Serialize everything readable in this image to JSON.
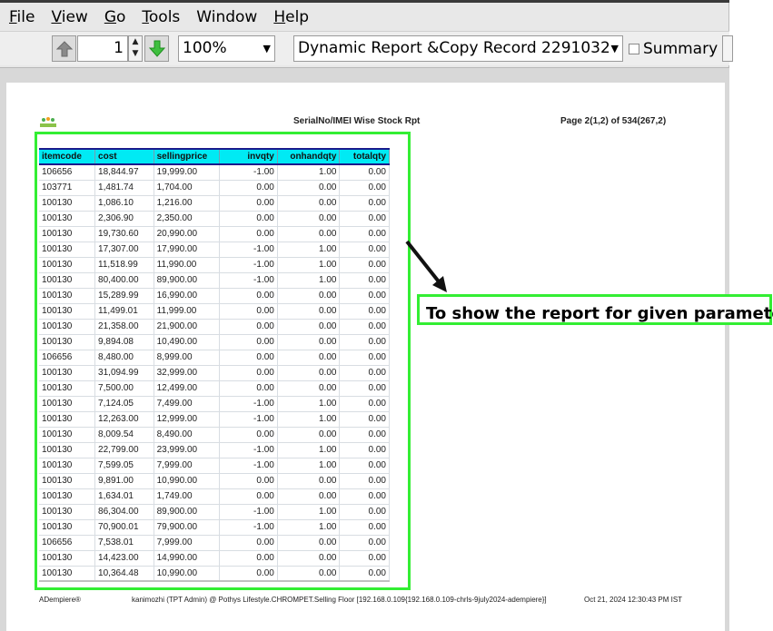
{
  "menu": [
    {
      "label": "File",
      "u": "F",
      "rest": "ile"
    },
    {
      "label": "View",
      "u": "V",
      "rest": "iew"
    },
    {
      "label": "Go",
      "u": "G",
      "rest": "o"
    },
    {
      "label": "Tools",
      "u": "T",
      "rest": "ools"
    },
    {
      "label": "Window",
      "u": "",
      "rest": "Window"
    },
    {
      "label": "Help",
      "u": "H",
      "rest": "elp"
    }
  ],
  "toolbar": {
    "page_value": "1",
    "zoom_value": "100%",
    "report_value": "Dynamic Report &Copy Record 2291032",
    "summary_label": "Summary",
    "summary_checked": false
  },
  "report": {
    "title": "SerialNo/IMEI Wise Stock Rpt",
    "page_info": "Page 2(1,2) of 534(267,2)",
    "columns": [
      "itemcode",
      "cost",
      "sellingprice",
      "invqty",
      "onhandqty",
      "totalqty"
    ],
    "rows": [
      [
        "106656",
        "18,844.97",
        "19,999.00",
        "-1.00",
        "1.00",
        "0.00"
      ],
      [
        "103771",
        "1,481.74",
        "1,704.00",
        "0.00",
        "0.00",
        "0.00"
      ],
      [
        "100130",
        "1,086.10",
        "1,216.00",
        "0.00",
        "0.00",
        "0.00"
      ],
      [
        "100130",
        "2,306.90",
        "2,350.00",
        "0.00",
        "0.00",
        "0.00"
      ],
      [
        "100130",
        "19,730.60",
        "20,990.00",
        "0.00",
        "0.00",
        "0.00"
      ],
      [
        "100130",
        "17,307.00",
        "17,990.00",
        "-1.00",
        "1.00",
        "0.00"
      ],
      [
        "100130",
        "11,518.99",
        "11,990.00",
        "-1.00",
        "1.00",
        "0.00"
      ],
      [
        "100130",
        "80,400.00",
        "89,900.00",
        "-1.00",
        "1.00",
        "0.00"
      ],
      [
        "100130",
        "15,289.99",
        "16,990.00",
        "0.00",
        "0.00",
        "0.00"
      ],
      [
        "100130",
        "11,499.01",
        "11,999.00",
        "0.00",
        "0.00",
        "0.00"
      ],
      [
        "100130",
        "21,358.00",
        "21,900.00",
        "0.00",
        "0.00",
        "0.00"
      ],
      [
        "100130",
        "9,894.08",
        "10,490.00",
        "0.00",
        "0.00",
        "0.00"
      ],
      [
        "106656",
        "8,480.00",
        "8,999.00",
        "0.00",
        "0.00",
        "0.00"
      ],
      [
        "100130",
        "31,094.99",
        "32,999.00",
        "0.00",
        "0.00",
        "0.00"
      ],
      [
        "100130",
        "7,500.00",
        "12,499.00",
        "0.00",
        "0.00",
        "0.00"
      ],
      [
        "100130",
        "7,124.05",
        "7,499.00",
        "-1.00",
        "1.00",
        "0.00"
      ],
      [
        "100130",
        "12,263.00",
        "12,999.00",
        "-1.00",
        "1.00",
        "0.00"
      ],
      [
        "100130",
        "8,009.54",
        "8,490.00",
        "0.00",
        "0.00",
        "0.00"
      ],
      [
        "100130",
        "22,799.00",
        "23,999.00",
        "-1.00",
        "1.00",
        "0.00"
      ],
      [
        "100130",
        "7,599.05",
        "7,999.00",
        "-1.00",
        "1.00",
        "0.00"
      ],
      [
        "100130",
        "9,891.00",
        "10,990.00",
        "0.00",
        "0.00",
        "0.00"
      ],
      [
        "100130",
        "1,634.01",
        "1,749.00",
        "0.00",
        "0.00",
        "0.00"
      ],
      [
        "100130",
        "86,304.00",
        "89,900.00",
        "-1.00",
        "1.00",
        "0.00"
      ],
      [
        "100130",
        "70,900.01",
        "79,900.00",
        "-1.00",
        "1.00",
        "0.00"
      ],
      [
        "106656",
        "7,538.01",
        "7,999.00",
        "0.00",
        "0.00",
        "0.00"
      ],
      [
        "100130",
        "14,423.00",
        "14,990.00",
        "0.00",
        "0.00",
        "0.00"
      ],
      [
        "100130",
        "10,364.48",
        "10,990.00",
        "0.00",
        "0.00",
        "0.00"
      ]
    ],
    "footer_left": "ADempiere®",
    "footer_mid": "kanimozhi (TPT Admin) @ Pothys Lifestyle.CHROMPET.Selling Floor [192.168.0.109{192.168.0.109-chrls-9july2024-adempiere}]",
    "footer_right": "Oct 21, 2024 12:30:43 PM IST"
  },
  "annotation": {
    "callout_text": "To show the report for given parameter",
    "highlight_color": "#33ee33"
  }
}
